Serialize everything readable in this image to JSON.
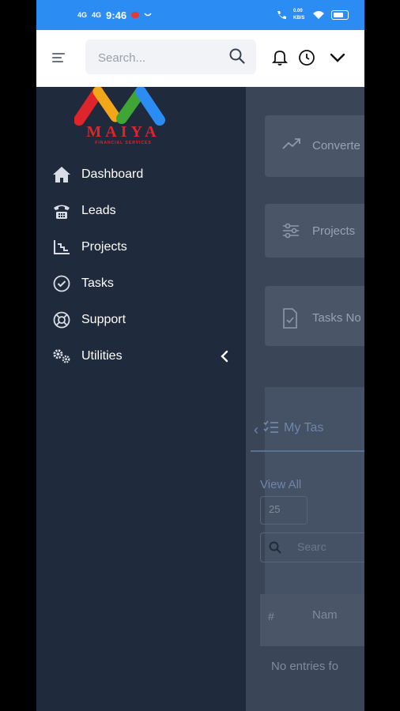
{
  "statusbar": {
    "signal1": "4G",
    "signal2": "4G",
    "time": "9:46",
    "net_speed": "0.00 KB/S"
  },
  "topbar": {
    "search_placeholder": "Search..."
  },
  "brand": {
    "name": "MAIYA",
    "tagline": "FINANCIAL SERVICES",
    "colors": [
      "#e0242b",
      "#f2a71b",
      "#3fa535",
      "#2b8cf4"
    ]
  },
  "sidebar": {
    "items": [
      {
        "label": "Dashboard",
        "icon": "home-icon"
      },
      {
        "label": "Leads",
        "icon": "phone-icon"
      },
      {
        "label": "Projects",
        "icon": "chart-icon"
      },
      {
        "label": "Tasks",
        "icon": "check-circle-icon"
      },
      {
        "label": "Support",
        "icon": "lifebuoy-icon"
      },
      {
        "label": "Utilities",
        "icon": "cogs-icon"
      }
    ]
  },
  "main": {
    "cards": [
      {
        "label": "Converte",
        "icon": "trend-icon"
      },
      {
        "label": "Projects",
        "icon": "sliders-icon"
      },
      {
        "label": "Tasks No",
        "icon": "file-check-icon"
      }
    ],
    "tab_label": "My Tas",
    "view_all": "View All",
    "page_size": "25",
    "search_placeholder": "Searc",
    "col_hash": "#",
    "col_name": "Nam",
    "empty": "No entries fo"
  },
  "accent": "#2b8cf4",
  "sidebar_bg": "#1f2a3c"
}
